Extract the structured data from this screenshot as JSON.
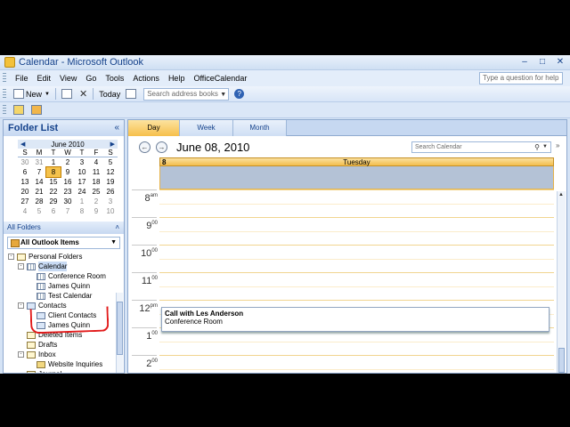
{
  "window": {
    "title": "Calendar - Microsoft Outlook"
  },
  "menu": {
    "items": [
      "File",
      "Edit",
      "View",
      "Go",
      "Tools",
      "Actions",
      "Help",
      "OfficeCalendar"
    ],
    "help_placeholder": "Type a question for help"
  },
  "toolbar": {
    "new_label": "New",
    "today_label": "Today",
    "address_placeholder": "Search address books"
  },
  "folder_list": {
    "title": "Folder List",
    "collapse_glyph": "«",
    "all_folders_label": "All Folders",
    "all_outlook_items_label": "All Outlook Items",
    "tree": [
      {
        "label": "Personal Folders",
        "level": 0,
        "expander": "-",
        "icon": "pf"
      },
      {
        "label": "Calendar",
        "level": 1,
        "expander": "-",
        "icon": "cal",
        "highlight": true
      },
      {
        "label": "Conference Room",
        "level": 2,
        "expander": "",
        "icon": "cal"
      },
      {
        "label": "James Quinn",
        "level": 2,
        "expander": "",
        "icon": "cal"
      },
      {
        "label": "Test Calendar",
        "level": 2,
        "expander": "",
        "icon": "cal"
      },
      {
        "label": "Contacts",
        "level": 1,
        "expander": "-",
        "icon": "con"
      },
      {
        "label": "Client Contacts",
        "level": 2,
        "expander": "",
        "icon": "con"
      },
      {
        "label": "James Quinn",
        "level": 2,
        "expander": "",
        "icon": "con"
      },
      {
        "label": "Deleted Items",
        "level": 1,
        "expander": "",
        "icon": "mail"
      },
      {
        "label": "Drafts",
        "level": 1,
        "expander": "",
        "icon": "mail"
      },
      {
        "label": "Inbox",
        "level": 1,
        "expander": "-",
        "icon": "mail"
      },
      {
        "label": "Website Inquiries",
        "level": 2,
        "expander": "",
        "icon": "fold"
      },
      {
        "label": "Journal",
        "level": 1,
        "expander": "",
        "icon": "mail"
      }
    ]
  },
  "minical": {
    "month": "June 2010",
    "dow": [
      "S",
      "M",
      "T",
      "W",
      "T",
      "F",
      "S"
    ],
    "weeks": [
      [
        {
          "d": "30",
          "o": 1
        },
        {
          "d": "31",
          "o": 1
        },
        {
          "d": "1"
        },
        {
          "d": "2"
        },
        {
          "d": "3"
        },
        {
          "d": "4"
        },
        {
          "d": "5"
        }
      ],
      [
        {
          "d": "6"
        },
        {
          "d": "7"
        },
        {
          "d": "8",
          "s": 1
        },
        {
          "d": "9"
        },
        {
          "d": "10"
        },
        {
          "d": "11"
        },
        {
          "d": "12"
        }
      ],
      [
        {
          "d": "13"
        },
        {
          "d": "14"
        },
        {
          "d": "15"
        },
        {
          "d": "16"
        },
        {
          "d": "17"
        },
        {
          "d": "18"
        },
        {
          "d": "19"
        }
      ],
      [
        {
          "d": "20"
        },
        {
          "d": "21"
        },
        {
          "d": "22"
        },
        {
          "d": "23"
        },
        {
          "d": "24"
        },
        {
          "d": "25"
        },
        {
          "d": "26"
        }
      ],
      [
        {
          "d": "27"
        },
        {
          "d": "28"
        },
        {
          "d": "29"
        },
        {
          "d": "30"
        },
        {
          "d": "1",
          "o": 1
        },
        {
          "d": "2",
          "o": 1
        },
        {
          "d": "3",
          "o": 1
        }
      ],
      [
        {
          "d": "4",
          "o": 1
        },
        {
          "d": "5",
          "o": 1
        },
        {
          "d": "6",
          "o": 1
        },
        {
          "d": "7",
          "o": 1
        },
        {
          "d": "8",
          "o": 1
        },
        {
          "d": "9",
          "o": 1
        },
        {
          "d": "10",
          "o": 1
        }
      ]
    ]
  },
  "calendar": {
    "tabs": [
      "Day",
      "Week",
      "Month"
    ],
    "active_tab": "Day",
    "date_title": "June 08, 2010",
    "search_placeholder": "Search Calendar",
    "day_number": "8",
    "day_name": "Tuesday",
    "hours": [
      {
        "h": "8",
        "s": "am"
      },
      {
        "h": "9",
        "s": "00"
      },
      {
        "h": "10",
        "s": "00"
      },
      {
        "h": "11",
        "s": "00"
      },
      {
        "h": "12",
        "s": "pm"
      },
      {
        "h": "1",
        "s": "00"
      },
      {
        "h": "2",
        "s": "00"
      }
    ],
    "appointment": {
      "title": "Call with Les Anderson",
      "location": "Conference Room"
    }
  }
}
